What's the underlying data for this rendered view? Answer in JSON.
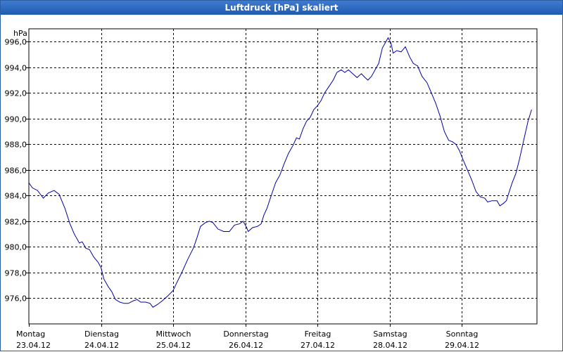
{
  "window": {
    "title": "Luftdruck [hPa] skaliert"
  },
  "colors": {
    "title_bar": "#2a64b8",
    "line": "#0000aa",
    "grid": "#000000",
    "background": "#ffffff"
  },
  "chart_data": {
    "type": "line",
    "title": "Luftdruck [hPa] skaliert",
    "ylabel": "hPa",
    "xlabel": "",
    "grid": true,
    "ylim": [
      974.0,
      997.0
    ],
    "y_ticks": [
      {
        "value": 976,
        "label": "976,0"
      },
      {
        "value": 978,
        "label": "978,0"
      },
      {
        "value": 980,
        "label": "980,0"
      },
      {
        "value": 982,
        "label": "982,0"
      },
      {
        "value": 984,
        "label": "984,0"
      },
      {
        "value": 986,
        "label": "986,0"
      },
      {
        "value": 988,
        "label": "988,0"
      },
      {
        "value": 990,
        "label": "990,0"
      },
      {
        "value": 992,
        "label": "992,0"
      },
      {
        "value": 994,
        "label": "994,0"
      },
      {
        "value": 996,
        "label": "996,0"
      }
    ],
    "x_unit": "day",
    "xlim": [
      0,
      7
    ],
    "x_ticks": [
      {
        "value": 0,
        "day": "Montag",
        "date": "23.04.12"
      },
      {
        "value": 1,
        "day": "Dienstag",
        "date": "24.04.12"
      },
      {
        "value": 2,
        "day": "Mittwoch",
        "date": "25.04.12"
      },
      {
        "value": 3,
        "day": "Donnerstag",
        "date": "26.04.12"
      },
      {
        "value": 4,
        "day": "Freitag",
        "date": "27.04.12"
      },
      {
        "value": 5,
        "day": "Samstag",
        "date": "28.04.12"
      },
      {
        "value": 6,
        "day": "Sonntag",
        "date": "29.04.12"
      }
    ],
    "series": [
      {
        "values": [
          [
            0.0,
            985.0
          ],
          [
            0.05,
            984.6
          ],
          [
            0.12,
            984.4
          ],
          [
            0.2,
            983.8
          ],
          [
            0.27,
            984.2
          ],
          [
            0.35,
            984.4
          ],
          [
            0.42,
            984.1
          ],
          [
            0.5,
            983.0
          ],
          [
            0.57,
            981.8
          ],
          [
            0.63,
            981.0
          ],
          [
            0.7,
            980.3
          ],
          [
            0.74,
            980.4
          ],
          [
            0.79,
            979.9
          ],
          [
            0.84,
            979.8
          ],
          [
            0.9,
            979.2
          ],
          [
            0.96,
            978.8
          ],
          [
            1.0,
            978.4
          ],
          [
            1.04,
            977.5
          ],
          [
            1.1,
            976.9
          ],
          [
            1.15,
            976.5
          ],
          [
            1.2,
            975.9
          ],
          [
            1.26,
            975.7
          ],
          [
            1.32,
            975.6
          ],
          [
            1.38,
            975.6
          ],
          [
            1.45,
            975.8
          ],
          [
            1.5,
            975.9
          ],
          [
            1.55,
            975.7
          ],
          [
            1.62,
            975.7
          ],
          [
            1.68,
            975.6
          ],
          [
            1.72,
            975.3
          ],
          [
            1.78,
            975.5
          ],
          [
            1.85,
            975.8
          ],
          [
            1.93,
            976.2
          ],
          [
            2.0,
            976.6
          ],
          [
            2.05,
            977.2
          ],
          [
            2.12,
            978.0
          ],
          [
            2.2,
            979.0
          ],
          [
            2.28,
            979.9
          ],
          [
            2.33,
            980.7
          ],
          [
            2.38,
            981.6
          ],
          [
            2.45,
            981.9
          ],
          [
            2.5,
            982.0
          ],
          [
            2.55,
            981.9
          ],
          [
            2.62,
            981.4
          ],
          [
            2.7,
            981.2
          ],
          [
            2.78,
            981.2
          ],
          [
            2.85,
            981.7
          ],
          [
            2.92,
            981.8
          ],
          [
            2.97,
            982.0
          ],
          [
            3.02,
            981.5
          ],
          [
            3.04,
            981.2
          ],
          [
            3.1,
            981.5
          ],
          [
            3.17,
            981.6
          ],
          [
            3.22,
            981.8
          ],
          [
            3.26,
            982.5
          ],
          [
            3.3,
            983.0
          ],
          [
            3.36,
            984.0
          ],
          [
            3.42,
            985.0
          ],
          [
            3.48,
            985.6
          ],
          [
            3.54,
            986.5
          ],
          [
            3.6,
            987.3
          ],
          [
            3.66,
            987.9
          ],
          [
            3.71,
            988.5
          ],
          [
            3.75,
            988.4
          ],
          [
            3.8,
            989.2
          ],
          [
            3.85,
            989.8
          ],
          [
            3.9,
            990.1
          ],
          [
            3.95,
            990.7
          ],
          [
            4.0,
            991.0
          ],
          [
            4.05,
            991.4
          ],
          [
            4.1,
            992.0
          ],
          [
            4.16,
            992.5
          ],
          [
            4.22,
            993.0
          ],
          [
            4.27,
            993.6
          ],
          [
            4.33,
            993.8
          ],
          [
            4.38,
            993.6
          ],
          [
            4.43,
            993.8
          ],
          [
            4.49,
            993.5
          ],
          [
            4.55,
            993.2
          ],
          [
            4.61,
            993.5
          ],
          [
            4.66,
            993.2
          ],
          [
            4.7,
            993.0
          ],
          [
            4.75,
            993.3
          ],
          [
            4.8,
            993.8
          ],
          [
            4.85,
            994.3
          ],
          [
            4.9,
            995.5
          ],
          [
            4.95,
            996.0
          ],
          [
            4.98,
            996.3
          ],
          [
            5.02,
            995.9
          ],
          [
            5.05,
            995.1
          ],
          [
            5.1,
            995.3
          ],
          [
            5.16,
            995.2
          ],
          [
            5.22,
            995.6
          ],
          [
            5.28,
            994.8
          ],
          [
            5.33,
            994.3
          ],
          [
            5.39,
            994.1
          ],
          [
            5.45,
            993.3
          ],
          [
            5.52,
            992.8
          ],
          [
            5.58,
            992.0
          ],
          [
            5.64,
            991.2
          ],
          [
            5.7,
            990.2
          ],
          [
            5.76,
            989.0
          ],
          [
            5.82,
            988.3
          ],
          [
            5.87,
            988.2
          ],
          [
            5.92,
            988.0
          ],
          [
            5.97,
            987.5
          ],
          [
            6.02,
            986.8
          ],
          [
            6.08,
            986.0
          ],
          [
            6.14,
            985.2
          ],
          [
            6.2,
            984.3
          ],
          [
            6.26,
            983.9
          ],
          [
            6.32,
            983.8
          ],
          [
            6.36,
            983.5
          ],
          [
            6.42,
            983.6
          ],
          [
            6.49,
            983.6
          ],
          [
            6.53,
            983.2
          ],
          [
            6.58,
            983.4
          ],
          [
            6.62,
            983.6
          ],
          [
            6.66,
            984.3
          ],
          [
            6.7,
            985.0
          ],
          [
            6.75,
            985.7
          ],
          [
            6.8,
            986.8
          ],
          [
            6.86,
            988.3
          ],
          [
            6.92,
            989.8
          ],
          [
            6.97,
            990.7
          ]
        ]
      }
    ]
  }
}
